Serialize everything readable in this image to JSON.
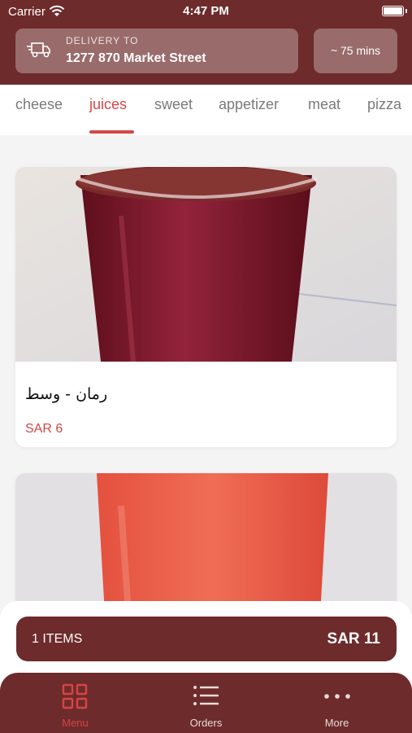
{
  "status_bar": {
    "carrier": "Carrier",
    "time": "4:47 PM"
  },
  "delivery": {
    "label": "DELIVERY TO",
    "address": "1277 870 Market Street",
    "eta": "~ 75 mins"
  },
  "tabs": [
    {
      "label": "cheese",
      "active": false
    },
    {
      "label": "juices",
      "active": true
    },
    {
      "label": "sweet",
      "active": false
    },
    {
      "label": "appetizer",
      "active": false
    },
    {
      "label": "meat",
      "active": false
    },
    {
      "label": "pizza",
      "active": false
    }
  ],
  "products": [
    {
      "name": "رمان - وسط",
      "price": "SAR 6"
    },
    {
      "name": "",
      "price": ""
    }
  ],
  "cart": {
    "count": "1 ITEMS",
    "total": "SAR 11"
  },
  "nav": [
    {
      "label": "Menu",
      "icon": "grid-icon",
      "active": true
    },
    {
      "label": "Orders",
      "icon": "list-icon",
      "active": false
    },
    {
      "label": "More",
      "icon": "more-dots-icon",
      "active": false
    }
  ],
  "colors": {
    "brand": "#6e2b2b",
    "accent": "#d64545"
  }
}
